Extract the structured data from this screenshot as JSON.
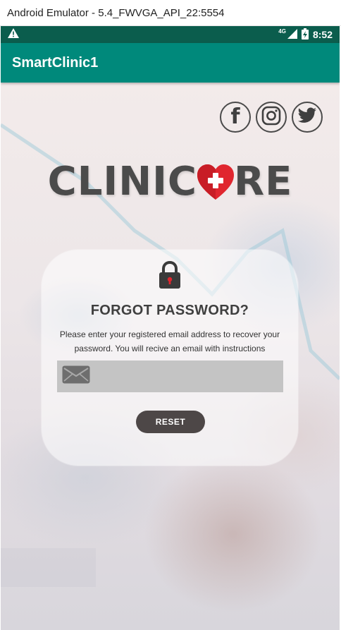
{
  "window": {
    "title": "Android Emulator - 5.4_FWVGA_API_22:5554"
  },
  "status_bar": {
    "network": "4G",
    "time": "8:52",
    "warning_icon": "warning-icon",
    "signal_icon": "signal-icon",
    "battery_icon": "battery-charging-icon"
  },
  "app_bar": {
    "title": "SmartClinic1"
  },
  "social": [
    {
      "icon": "facebook-icon",
      "label": "f"
    },
    {
      "icon": "instagram-icon"
    },
    {
      "icon": "twitter-icon"
    }
  ],
  "logo": {
    "text_left": "CLINIC",
    "text_right": "RE",
    "icon": "heart-cross-icon"
  },
  "forgot": {
    "lock_icon": "lock-icon",
    "title": "FORGOT PASSWORD?",
    "description": "Please enter your registered email address to recover your password. You will recive an email with instructions",
    "email_icon": "envelope-icon",
    "email_value": "",
    "email_placeholder": "",
    "reset_label": "RESET"
  },
  "colors": {
    "status_bar": "#0b5d4d",
    "app_bar": "#00897b",
    "button": "#4d4747",
    "heart": "#e0262f"
  }
}
